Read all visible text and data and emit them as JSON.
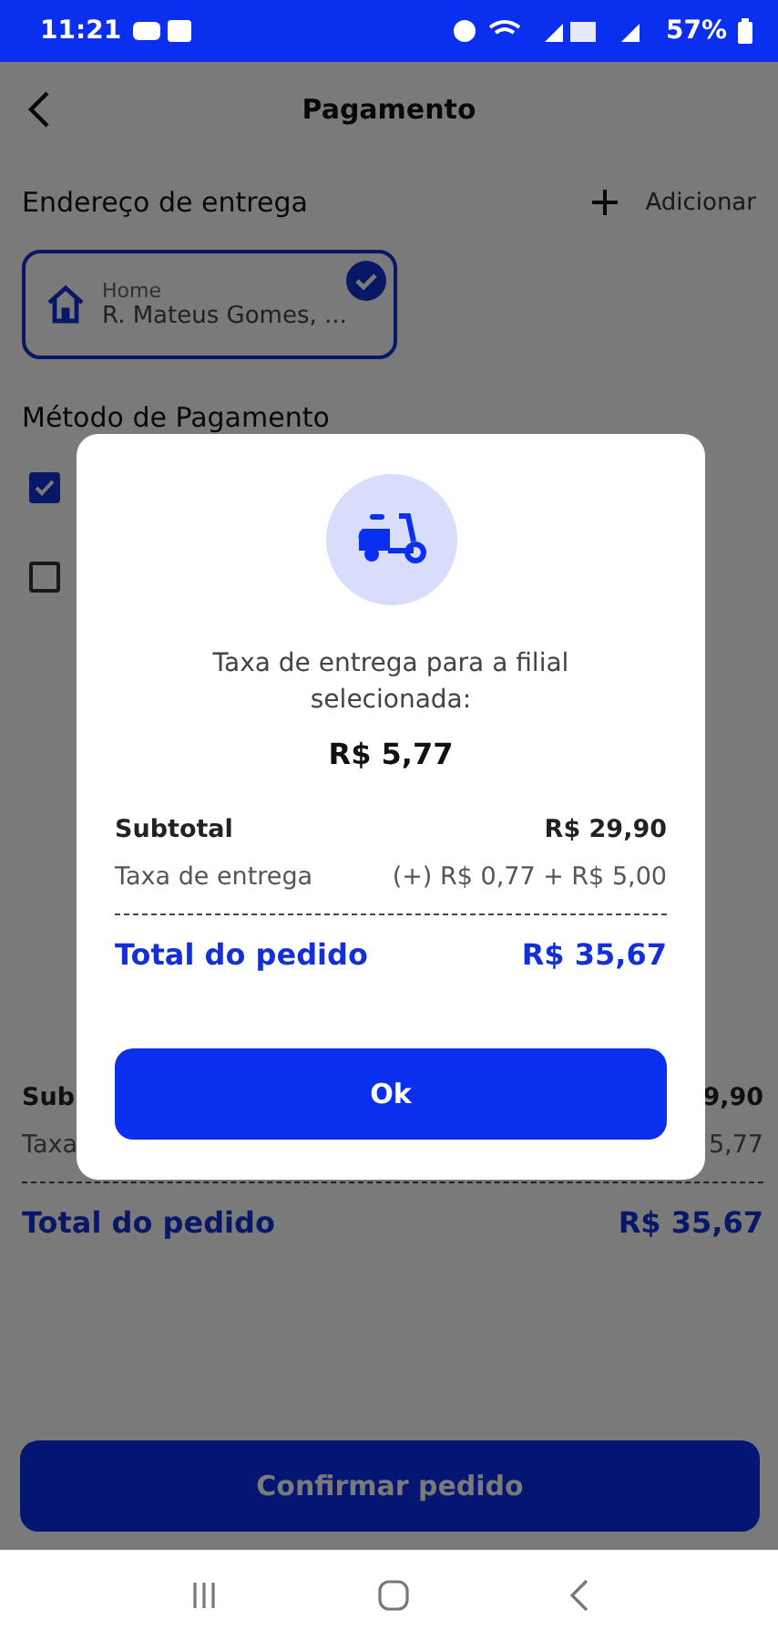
{
  "status_bar": {
    "time": "11:21",
    "battery": "57%"
  },
  "header": {
    "title": "Pagamento"
  },
  "address_section": {
    "title": "Endereço de entrega",
    "add_label": "Adicionar"
  },
  "address_card": {
    "label": "Home",
    "address": "R. Mateus Gomes, ...",
    "selected": true
  },
  "payment_section": {
    "title": "Método de Pagamento",
    "options": [
      {
        "checked": true
      },
      {
        "checked": false
      }
    ]
  },
  "summary": [
    {
      "kind": "subtotal",
      "label": "Sub",
      "value": "9,90"
    },
    {
      "kind": "fee",
      "label": "Taxa",
      "value": "5,77"
    },
    {
      "kind": "total",
      "label": "Total do pedido",
      "value": "R$ 35,67"
    }
  ],
  "confirm_button": "Confirmar pedido",
  "dialog": {
    "message": "Taxa de entrega para a filial selecionada:",
    "amount": "R$ 5,77",
    "rows": [
      {
        "kind": "subtotal",
        "label": "Subtotal",
        "value": "R$ 29,90"
      },
      {
        "kind": "fee",
        "label": "Taxa de entrega",
        "value": "(+) R$ 0,77 + R$ 5,00"
      },
      {
        "kind": "total",
        "label": "Total do pedido",
        "value": "R$ 35,67"
      }
    ],
    "button": "Ok"
  }
}
